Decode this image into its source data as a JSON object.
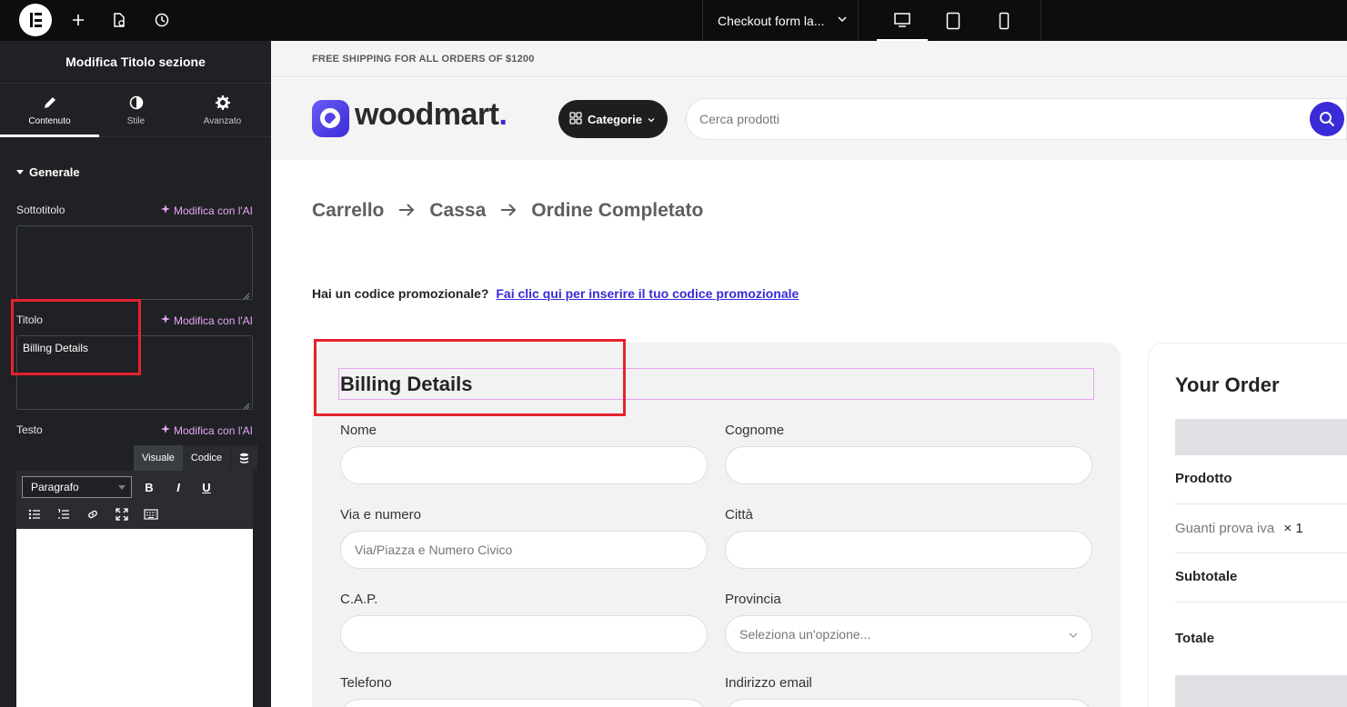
{
  "topbar": {
    "document_title": "Checkout form la...",
    "icons": [
      "elementor-logo-icon",
      "add-icon",
      "page-settings-icon",
      "history-icon",
      "chevron-down-icon",
      "desktop-icon",
      "tablet-icon",
      "mobile-icon"
    ]
  },
  "panel": {
    "title": "Modifica Titolo sezione",
    "tabs": [
      {
        "label": "Contenuto",
        "icon": "pencil-icon"
      },
      {
        "label": "Stile",
        "icon": "contrast-icon"
      },
      {
        "label": "Avanzato",
        "icon": "gear-icon"
      }
    ],
    "section": "Generale",
    "ai_label": "Modifica con l'AI",
    "subtitle_label": "Sottotitolo",
    "subtitle_value": "",
    "title_label": "Titolo",
    "title_value": "Billing Details",
    "text_label": "Testo",
    "editor_tabs": {
      "visual": "Visuale",
      "code": "Codice"
    },
    "paragraph_select": "Paragrafo",
    "format_buttons": [
      "B",
      "I",
      "U"
    ]
  },
  "site": {
    "shipping_banner": "FREE SHIPPING FOR ALL ORDERS OF $1200",
    "logo_text": "woodmart",
    "logo_dot": ".",
    "categories_button": "Categorie",
    "search_placeholder": "Cerca prodotti",
    "steps": [
      "Carrello",
      "Cassa",
      "Ordine Completato"
    ],
    "promo_text": "Hai un codice promozionale?",
    "promo_link": "Fai clic qui per inserire il tuo codice promozionale",
    "billing": {
      "title": "Billing Details",
      "first_name_label": "Nome",
      "last_name_label": "Cognome",
      "street_label": "Via e numero",
      "street_placeholder": "Via/Piazza e Numero Civico",
      "city_label": "Città",
      "zip_label": "C.A.P.",
      "province_label": "Provincia",
      "province_placeholder": "Seleziona un'opzione...",
      "phone_label": "Telefono",
      "email_label": "Indirizzo email"
    },
    "order": {
      "title": "Your Order",
      "product_header": "Prodotto",
      "product_name": "Guanti prova iva",
      "product_qty": "× 1",
      "subtotal_label": "Subtotale",
      "total_label": "Totale"
    }
  },
  "colors": {
    "accent": "#3a2bd8",
    "highlight_box": "#e5222d",
    "editor_bg": "#1f2124",
    "ai_link": "#e7a6f5"
  }
}
